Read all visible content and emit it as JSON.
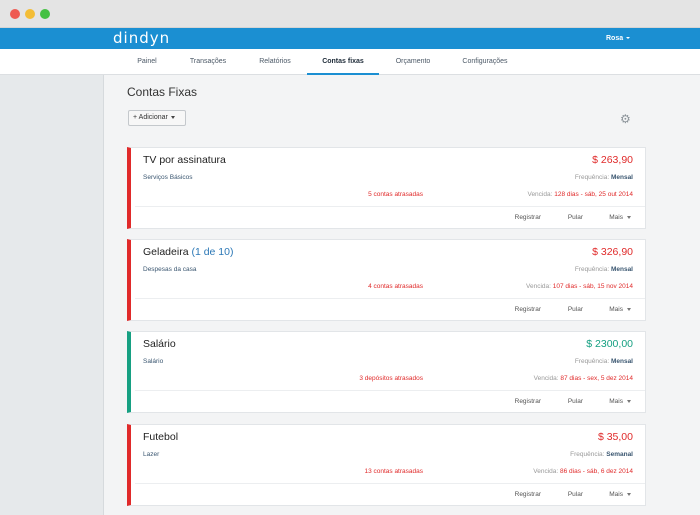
{
  "app": {
    "logo": "dindyn",
    "user_name": "Rosa"
  },
  "nav": {
    "items": [
      {
        "label": "Painel"
      },
      {
        "label": "Transações"
      },
      {
        "label": "Relatórios"
      },
      {
        "label": "Contas fixas"
      },
      {
        "label": "Orçamento"
      },
      {
        "label": "Configurações"
      }
    ],
    "active": "Contas fixas"
  },
  "page": {
    "title": "Contas Fixas",
    "add_button": "+  Adicionar"
  },
  "cards": [
    {
      "title": "TV por assinatura",
      "count": "",
      "amount": "$ 263,90",
      "category": "Serviços Básicos",
      "frequency_label": "Frequência:",
      "frequency": "Mensal",
      "overdue": "5 contas atrasadas",
      "due_label": "Vencida:",
      "due": "128 dias - sáb, 25 out 2014",
      "status": "expense"
    },
    {
      "title": "Geladeira",
      "count": "(1 de 10)",
      "amount": "$ 326,90",
      "category": "Despesas da casa",
      "frequency_label": "Frequência:",
      "frequency": "Mensal",
      "overdue": "4 contas atrasadas",
      "due_label": "Vencida:",
      "due": "107 dias - sáb, 15 nov 2014",
      "status": "expense"
    },
    {
      "title": "Salário",
      "count": "",
      "amount": "$ 2300,00",
      "category": "Salário",
      "frequency_label": "Frequência:",
      "frequency": "Mensal",
      "overdue": "3 depósitos atrasados",
      "due_label": "Vencida:",
      "due": "87 dias - sex, 5 dez 2014",
      "status": "income"
    },
    {
      "title": "Futebol",
      "count": "",
      "amount": "$ 35,00",
      "category": "Lazer",
      "frequency_label": "Frequência:",
      "frequency": "Semanal",
      "overdue": "13 contas atrasadas",
      "due_label": "Vencida:",
      "due": "86 dias - sáb, 6 dez 2014",
      "status": "expense"
    }
  ],
  "actions": {
    "register": "Registrar",
    "skip": "Pular",
    "more": "Mais"
  },
  "colors": {
    "brand": "#1b8fd2",
    "expense": "#e02a2a",
    "income": "#16a082"
  }
}
